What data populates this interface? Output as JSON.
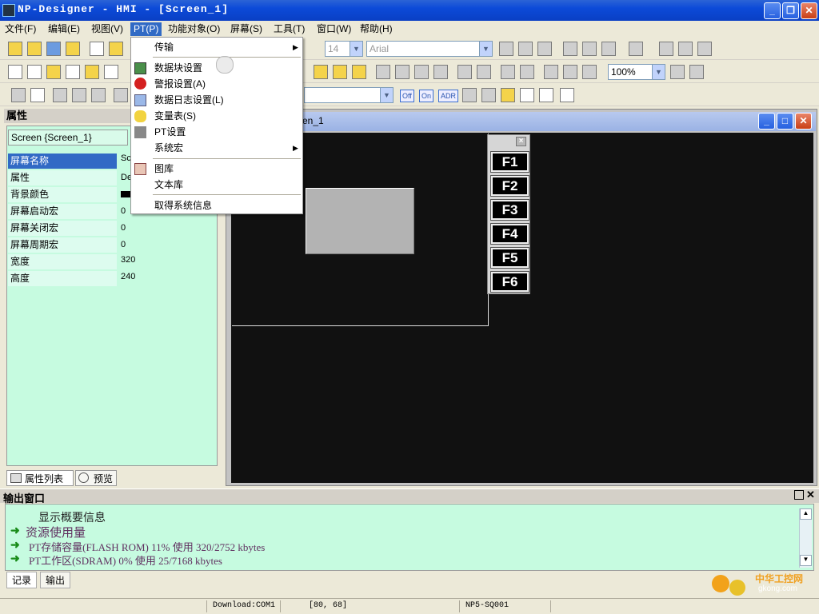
{
  "window": {
    "title": "NP-Designer - HMI - [Screen_1]"
  },
  "menubar": [
    {
      "label": "文件(F)"
    },
    {
      "label": "编辑(E)"
    },
    {
      "label": "视图(V)"
    },
    {
      "label": "PT(P)"
    },
    {
      "label": "功能对象(O)"
    },
    {
      "label": "屏幕(S)"
    },
    {
      "label": "工具(T)"
    },
    {
      "label": "窗口(W)"
    },
    {
      "label": "帮助(H)"
    }
  ],
  "pt_menu": {
    "items": [
      {
        "label": "传输",
        "submenu": true
      },
      {
        "label": "数据块设置"
      },
      {
        "label": "警报设置(A)"
      },
      {
        "label": "数据日志设置(L)"
      },
      {
        "label": "变量表(S)"
      },
      {
        "label": "PT设置"
      },
      {
        "label": "系统宏",
        "submenu": true
      },
      {
        "label": "图库"
      },
      {
        "label": "文本库"
      },
      {
        "label": "取得系统信息"
      }
    ]
  },
  "toolbar": {
    "font_size": "14",
    "font_name": "Arial",
    "zoom": "100%",
    "tags": [
      "Off",
      "On",
      "ADR"
    ]
  },
  "properties": {
    "header": "属性",
    "object": "Screen {Screen_1}",
    "rows": [
      {
        "name": "屏幕名称",
        "value": "Sc"
      },
      {
        "name": "属性",
        "value": "De"
      },
      {
        "name": "背景颜色",
        "value": ""
      },
      {
        "name": "屏幕启动宏",
        "value": "0"
      },
      {
        "name": "屏幕关闭宏",
        "value": "0"
      },
      {
        "name": "屏幕周期宏",
        "value": "0"
      },
      {
        "name": "宽度",
        "value": "320"
      },
      {
        "name": "高度",
        "value": "240"
      }
    ],
    "tabs": [
      {
        "label": "属性列表"
      },
      {
        "label": "预览"
      }
    ]
  },
  "editor": {
    "title_fragment": "en_1",
    "fkeys": [
      "F1",
      "F2",
      "F3",
      "F4",
      "F5",
      "F6"
    ]
  },
  "output": {
    "header": "输出窗口",
    "lines": [
      "显示概要信息",
      "资源使用量",
      "PT存储容量(FLASH ROM) 11% 使用 320/2752 kbytes",
      "PT工作区(SDRAM) 0% 使用 25/7168 kbytes"
    ],
    "tabs": [
      {
        "label": "记录"
      },
      {
        "label": "输出"
      }
    ]
  },
  "statusbar": {
    "download": "Download:COM1",
    "coords": "[80, 68]",
    "model": "NP5-SQ001"
  },
  "watermark": {
    "line1": "中华工控网",
    "line2": "gkong.com"
  },
  "colors": {
    "titlebar": "#0c4ad8",
    "selection": "#316ac5",
    "panel": "#c6fbe0",
    "canvas": "#111111"
  }
}
